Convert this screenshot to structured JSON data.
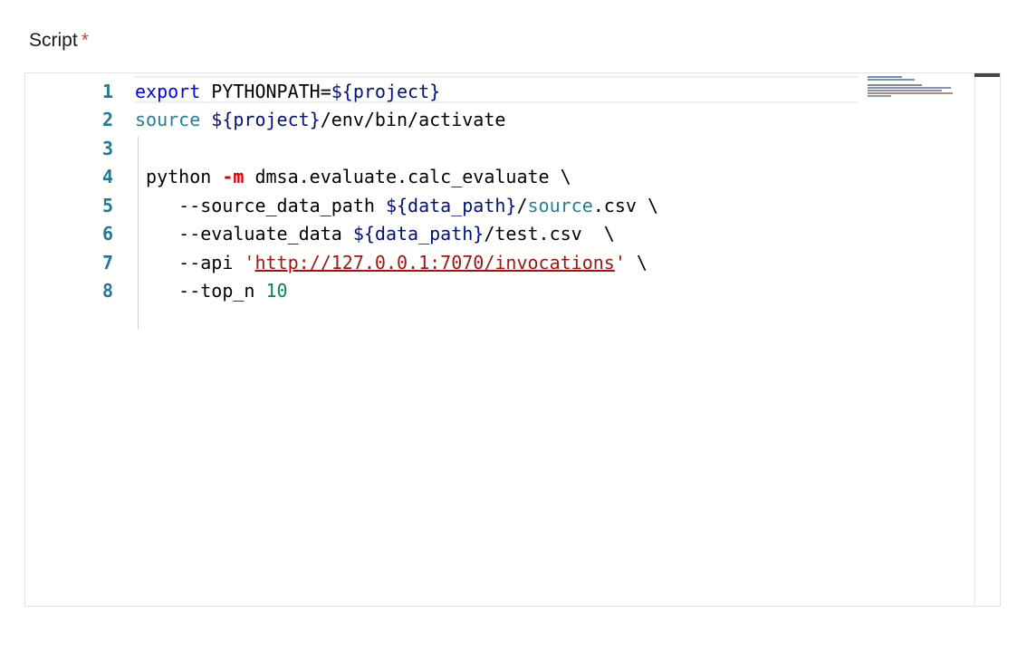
{
  "field": {
    "label": "Script",
    "required_mark": "*"
  },
  "editor": {
    "line_numbers": [
      "1",
      "2",
      "3",
      "4",
      "5",
      "6",
      "7",
      "8"
    ],
    "lines": {
      "l1": {
        "export": "export",
        "name": " PYTHONPATH=",
        "project": "${project}"
      },
      "l2": {
        "source": "source",
        "sp": " ",
        "project": "${project}",
        "path": "/env/bin/activate"
      },
      "l3": {
        "text": ""
      },
      "l4": {
        "indent": " ",
        "cmd": "python ",
        "flag": "-m",
        "module": " dmsa.evaluate.calc_evaluate \\"
      },
      "l5": {
        "arg": "    --source_data_path ",
        "var": "${data_path}",
        "slash": "/",
        "file": "source",
        "ext": ".csv \\"
      },
      "l6": {
        "arg": "    --evaluate_data ",
        "var": "${data_path}",
        "rest": "/test.csv  \\"
      },
      "l7": {
        "arg": "    --api ",
        "q1": "'",
        "url": "http://127.0.0.1:7070/invocations",
        "q2": "'",
        "rest": " \\"
      },
      "l8": {
        "arg": "    --top_n ",
        "num": "10"
      }
    }
  },
  "colors": {
    "keyword": "#0000ff",
    "variable": "#001080",
    "type_teal": "#267f99",
    "flag": "#e00000",
    "string": "#a31515",
    "number": "#098658",
    "line_number": "#237893",
    "required": "#e53935"
  }
}
